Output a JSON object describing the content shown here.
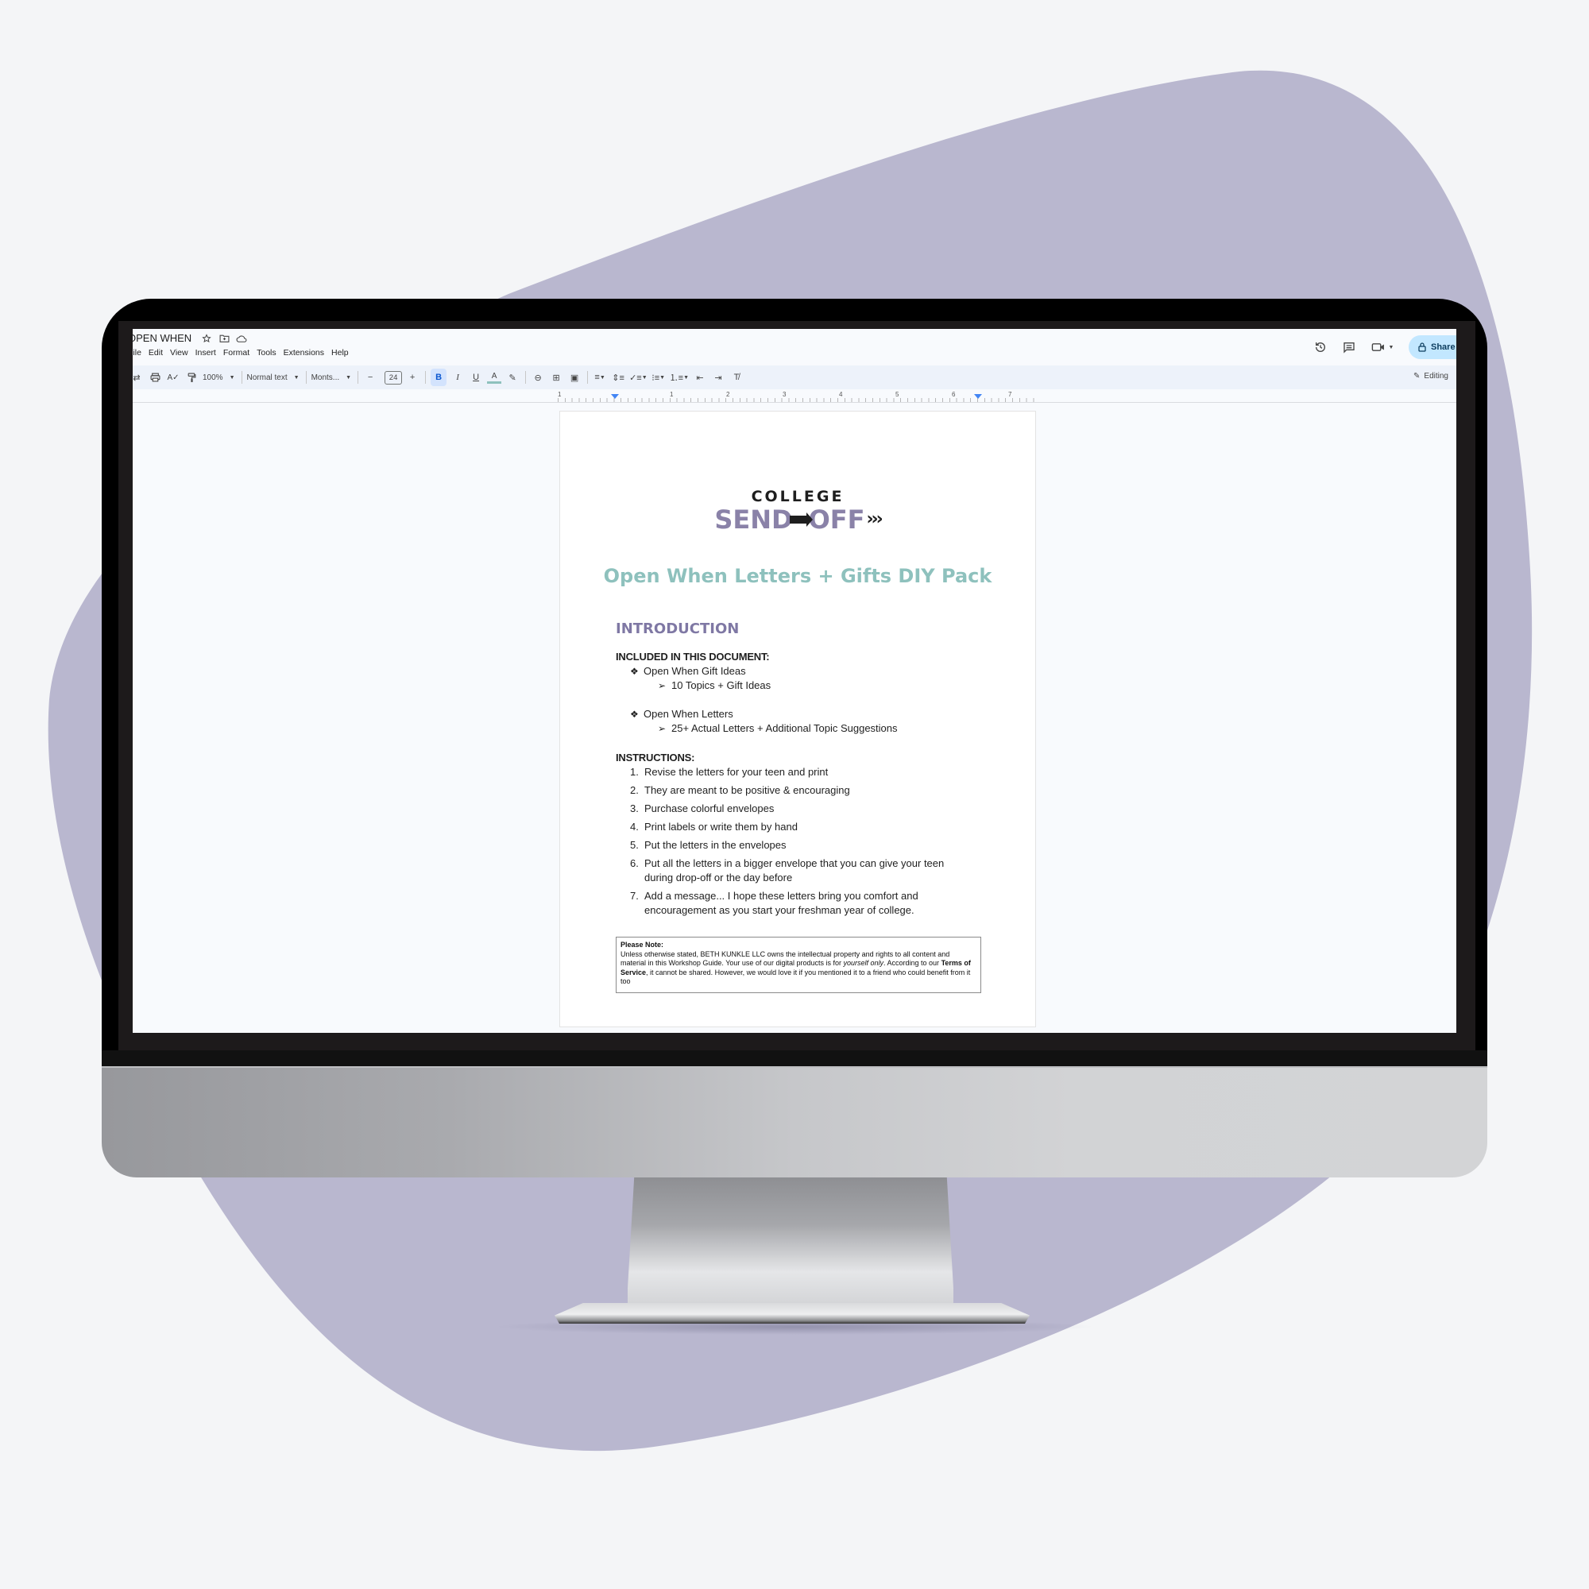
{
  "colors": {
    "background": "#f4f5f7",
    "blob": "#b9b7cf",
    "logo_purple": "#8a82a8",
    "heading_teal": "#8ec1bd",
    "intro_purple": "#7f78a4",
    "share_button": "#c2e7ff",
    "toolbar_bg": "#edf2fa"
  },
  "app": {
    "doc_title": "OPEN WHEN",
    "title_icons": [
      "star-icon",
      "move-to-folder-icon",
      "cloud-saved-icon"
    ],
    "menu": [
      "File",
      "Edit",
      "View",
      "Insert",
      "Format",
      "Tools",
      "Extensions",
      "Help"
    ],
    "header_actions": [
      "version-history-icon",
      "comments-icon",
      "meet-icon"
    ],
    "share_label": "Share"
  },
  "toolbar": {
    "zoom": "100%",
    "style": "Normal text",
    "font": "Monts...",
    "font_size": "24",
    "bold": "B",
    "italic": "I",
    "underline": "U",
    "text_color": "A",
    "mode": "Editing"
  },
  "ruler": {
    "labels": [
      "1",
      "1",
      "2",
      "3",
      "4",
      "5",
      "6",
      "7"
    ]
  },
  "document": {
    "logo_top": "COLLEGE",
    "logo_left": "SEND",
    "logo_right": "OFF",
    "logo_chevrons": "›››",
    "title": "Open When Letters + Gifts DIY Pack",
    "intro_heading": "INTRODUCTION",
    "included_label": "INCLUDED IN THIS DOCUMENT:",
    "included": [
      {
        "item": "Open When Gift Ideas",
        "sub": "10 Topics + Gift Ideas"
      },
      {
        "item": "Open When Letters",
        "sub": "25+ Actual Letters + Additional Topic Suggestions"
      }
    ],
    "bullet_glyph": "❖",
    "sub_bullet_glyph": "➢",
    "instructions_label": "INSTRUCTIONS:",
    "instructions": [
      "Revise the letters for your teen and print",
      "They are meant to be positive & encouraging",
      "Purchase colorful envelopes",
      "Print labels or write them by hand",
      "Put the letters in the envelopes",
      "Put all the letters in a bigger envelope that you can give your teen during drop-off or the day before",
      "Add a message... I hope these letters bring you comfort and encouragement as you start your freshman year of college."
    ],
    "note": {
      "label": "Please Note:",
      "text_1": "Unless otherwise stated, BETH KUNKLE LLC owns the intellectual property and rights to all content and material in this Workshop Guide. Your use of our digital products is for ",
      "italic": "yourself only",
      "text_2": ". According to our ",
      "bold": "Terms of Service",
      "text_3": ", it cannot be shared. However, we would love it if you mentioned it to a friend who could benefit from it too"
    }
  }
}
